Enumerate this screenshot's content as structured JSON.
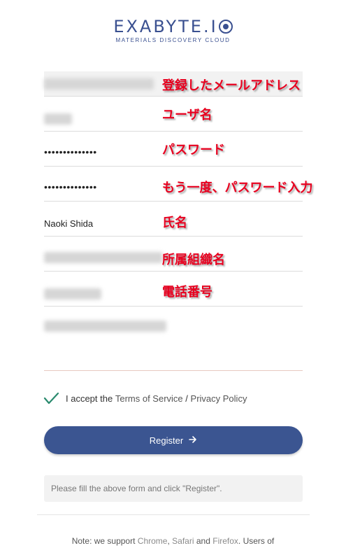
{
  "logo": {
    "title": "EXABYTE.I",
    "subtitle": "MATERIALS DISCOVERY CLOUD"
  },
  "form": {
    "email": {
      "note": "登録したメールアドレス"
    },
    "username": {
      "note": "ユーザ名"
    },
    "password": {
      "value": "••••••••••••••",
      "note": "パスワード"
    },
    "password_confirm": {
      "value": "••••••••••••••",
      "note": "もう一度、パスワード入力"
    },
    "full_name": {
      "value": "Naoki Shida",
      "note": "氏名"
    },
    "organization": {
      "note": "所属組織名"
    },
    "phone": {
      "note": "電話番号"
    }
  },
  "accept": {
    "prefix": "I accept the",
    "terms_link": "Terms of Service",
    "separator": "/",
    "privacy_link": "Privacy Policy",
    "checked": true
  },
  "register_button": {
    "label": "Register",
    "icon": "arrow-right-icon"
  },
  "status_message": "Please fill the above form and click \"Register\".",
  "footer": {
    "prefix": "Note: we support",
    "browser1": "Chrome",
    "comma": ",",
    "browser2": "Safari",
    "and_text": "and",
    "browser3": "Firefox",
    "suffix": ". Users of"
  },
  "colors": {
    "brand": "#3a5090",
    "button": "#3b5591",
    "annotation": "#e8001f",
    "check": "#2a8a6e"
  }
}
